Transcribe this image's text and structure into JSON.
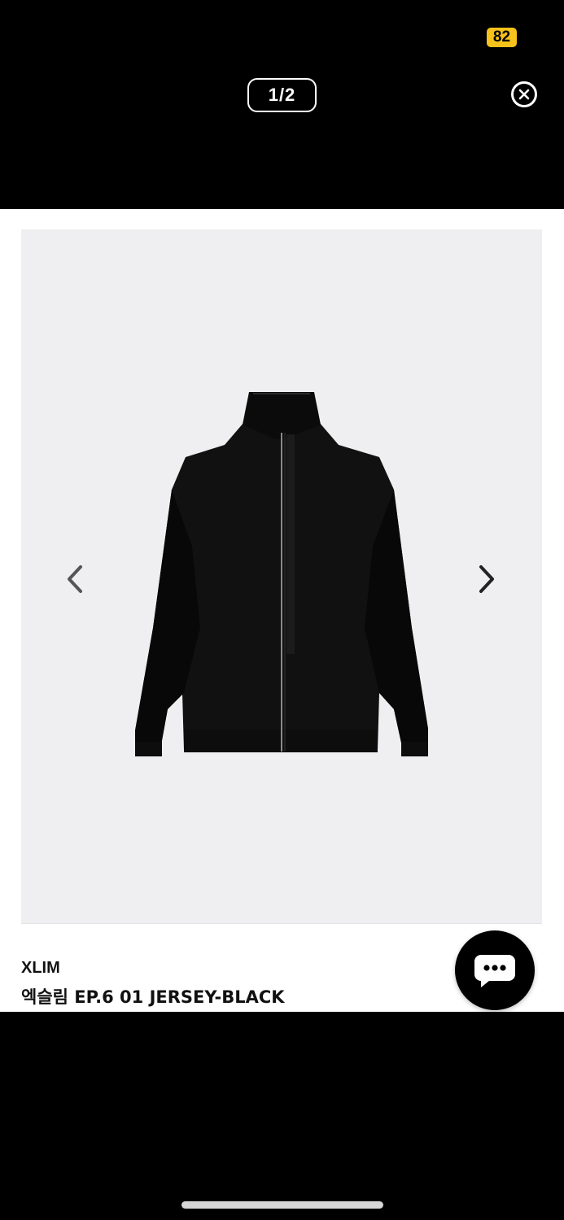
{
  "status_bar": {
    "battery_level": "82",
    "battery_color": "#f6c21b"
  },
  "viewer": {
    "page_counter": "1/2",
    "close_icon": "close-circle-icon"
  },
  "product": {
    "image_icon": "black-jacket-image",
    "brand": "XLIM",
    "name": "엑슬림 EP.6 01 JERSEY-BLACK"
  },
  "navigation": {
    "prev_icon": "chevron-left-icon",
    "next_icon": "chevron-right-icon"
  },
  "chat": {
    "icon": "chat-bubble-icon"
  }
}
